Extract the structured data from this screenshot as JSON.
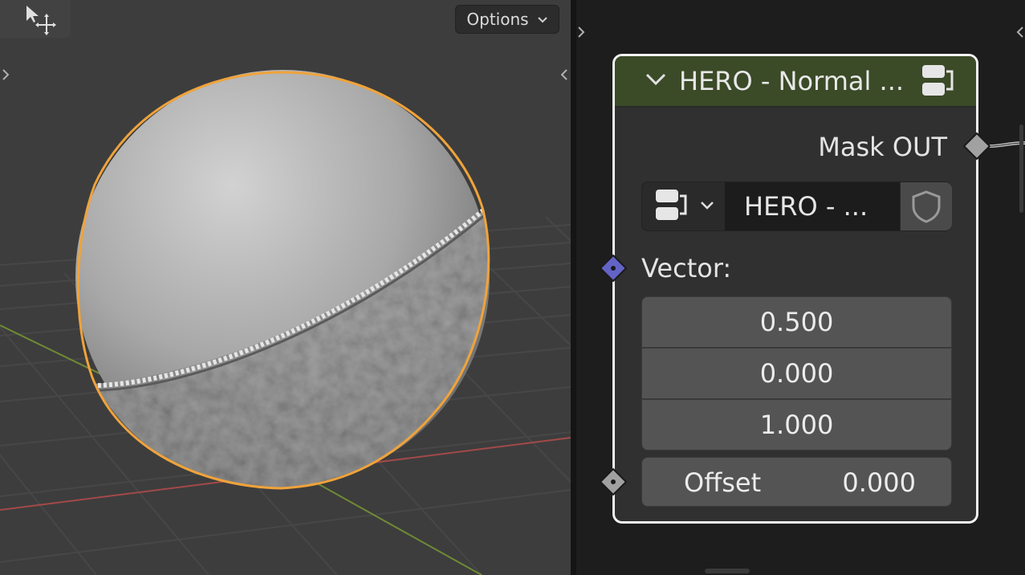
{
  "viewport": {
    "options_label": "Options",
    "tool_icon": "select-move-icon",
    "colors": {
      "background": "#3d3d3d",
      "grid": "#474747",
      "x_axis": "#a34949",
      "y_axis": "#6f8a35",
      "selection_outline": "#f0a33a",
      "sphere": "#b0b0b0"
    }
  },
  "node": {
    "title": "HERO - Normal ...",
    "header_color": "#3b4a27",
    "output_socket_label": "Mask OUT",
    "datablock": {
      "icon": "node-group-icon",
      "name": "HERO - ...",
      "fake_user_icon": "shield-icon"
    },
    "vector_label": "Vector:",
    "vector_values": [
      "0.500",
      "0.000",
      "1.000"
    ],
    "offset": {
      "label": "Offset",
      "value": "0.000"
    },
    "socket_colors": {
      "vector": "#6363c7",
      "float": "#a1a1a1"
    }
  }
}
